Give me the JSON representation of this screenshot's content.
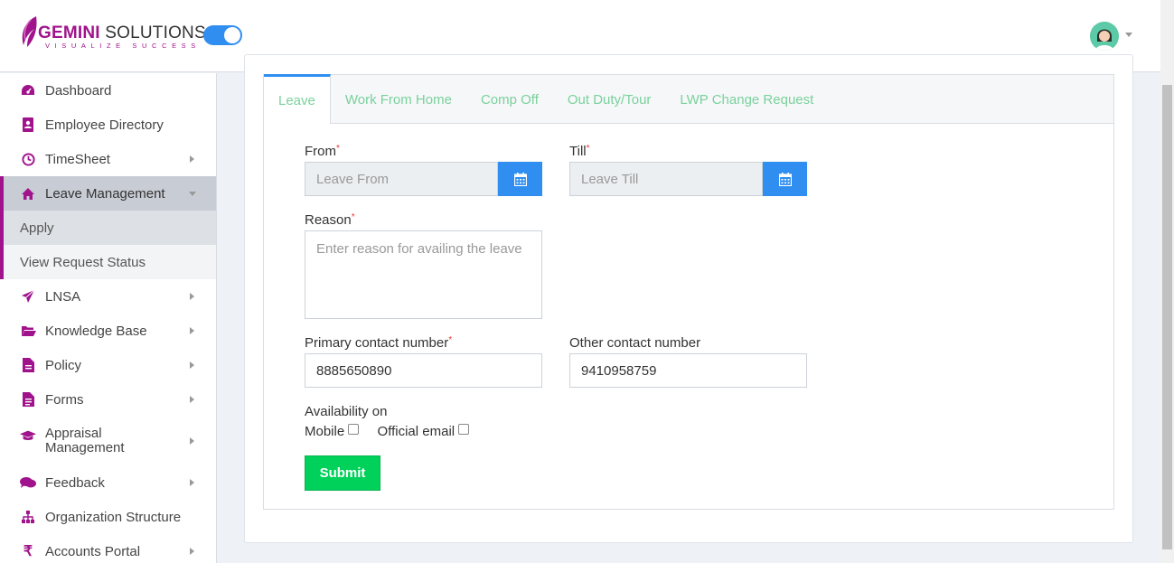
{
  "header": {
    "brand_bold": "GEMINI",
    "brand_rest": " SOLUTIONS",
    "tagline": "VISUALIZE SUCCESS",
    "toggle_on": true
  },
  "sidebar": {
    "items": [
      {
        "label": "Dashboard",
        "icon": "dashboard-icon"
      },
      {
        "label": "Employee Directory",
        "icon": "address-book-icon"
      },
      {
        "label": "TimeSheet",
        "icon": "clock-icon"
      },
      {
        "label": "Leave Management",
        "icon": "home-icon"
      },
      {
        "label": "LNSA",
        "icon": "paper-plane-icon"
      },
      {
        "label": "Knowledge Base",
        "icon": "folder-open-icon"
      },
      {
        "label": "Policy",
        "icon": "file-icon"
      },
      {
        "label": "Forms",
        "icon": "file-text-icon"
      },
      {
        "label": "Appraisal Management",
        "icon": "graduation-cap-icon"
      },
      {
        "label": "Feedback",
        "icon": "comments-icon"
      },
      {
        "label": "Organization Structure",
        "icon": "sitemap-icon"
      },
      {
        "label": "Accounts Portal",
        "icon": "rupee-icon"
      }
    ],
    "sub_items": [
      {
        "label": "Apply"
      },
      {
        "label": "View Request Status"
      }
    ]
  },
  "tabs": [
    {
      "label": "Leave"
    },
    {
      "label": "Work From Home"
    },
    {
      "label": "Comp Off"
    },
    {
      "label": "Out Duty/Tour"
    },
    {
      "label": "LWP Change Request"
    }
  ],
  "form": {
    "from_label": "From",
    "from_placeholder": "Leave From",
    "till_label": "Till",
    "till_placeholder": "Leave Till",
    "reason_label": "Reason",
    "reason_placeholder": "Enter reason for availing the leave",
    "primary_label": "Primary contact number",
    "primary_value": "8885650890",
    "other_label": "Other contact number",
    "other_value": "9410958759",
    "availability_label": "Availability on",
    "mobile_label": "Mobile",
    "email_label": "Official email",
    "required_mark": "*",
    "submit_label": "Submit"
  },
  "colors": {
    "brand": "#a0138c",
    "accent": "#2f8ef0",
    "tab_text": "#7ad19c",
    "submit": "#00d15a"
  }
}
